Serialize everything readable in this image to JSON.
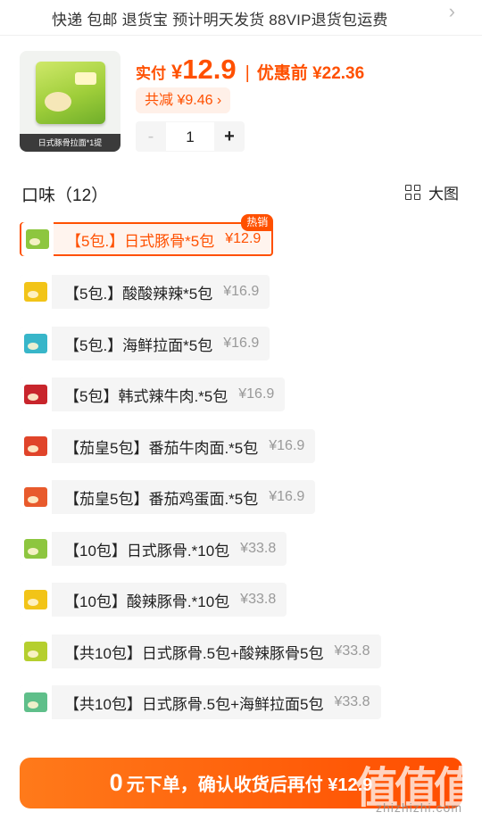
{
  "top_bar": {
    "services": "快递 包邮 退货宝 预计明天发货 88VIP退货包运费",
    "chevron_icon": "chevron-right-icon"
  },
  "product": {
    "image_caption": "日式豚骨拉面*1提",
    "pay_label": "实付",
    "currency": "¥",
    "pay_price": "12.9",
    "before_label": "优惠前 ¥22.36",
    "discount_label": "共减 ¥9.46 ›",
    "quantity": "1",
    "minus_label": "-",
    "plus_label": "+"
  },
  "flavors": {
    "title": "口味（12）",
    "big_view_label": "大图",
    "hot_badge": "热销",
    "options": [
      {
        "name": "【5包.】日式豚骨*5包",
        "price": "¥12.9",
        "selected": true,
        "color": "#8dc63f"
      },
      {
        "name": "【5包.】酸酸辣辣*5包",
        "price": "¥16.9",
        "selected": false,
        "color": "#f2c418"
      },
      {
        "name": "【5包.】海鲜拉面*5包",
        "price": "¥16.9",
        "selected": false,
        "color": "#38b6c9"
      },
      {
        "name": "【5包】韩式辣牛肉.*5包",
        "price": "¥16.9",
        "selected": false,
        "color": "#c8252c"
      },
      {
        "name": "【茄皇5包】番茄牛肉面.*5包",
        "price": "¥16.9",
        "selected": false,
        "color": "#e0442a"
      },
      {
        "name": "【茄皇5包】番茄鸡蛋面.*5包",
        "price": "¥16.9",
        "selected": false,
        "color": "#e85a2c"
      },
      {
        "name": "【10包】日式豚骨.*10包",
        "price": "¥33.8",
        "selected": false,
        "color": "#8dc63f"
      },
      {
        "name": "【10包】酸辣豚骨.*10包",
        "price": "¥33.8",
        "selected": false,
        "color": "#f2c418"
      },
      {
        "name": "【共10包】日式豚骨.5包+酸辣豚骨5包",
        "price": "¥33.8",
        "selected": false,
        "color": "#b5cf2e"
      },
      {
        "name": "【共10包】日式豚骨.5包+海鲜拉面5包",
        "price": "¥33.8",
        "selected": false,
        "color": "#5fbf8a"
      }
    ]
  },
  "cta": {
    "zero": "0",
    "text": "元下单，确认收货后再付 ¥12.9"
  },
  "watermark": {
    "glyphs": "值值值",
    "url": "zhizhizhi.com"
  }
}
